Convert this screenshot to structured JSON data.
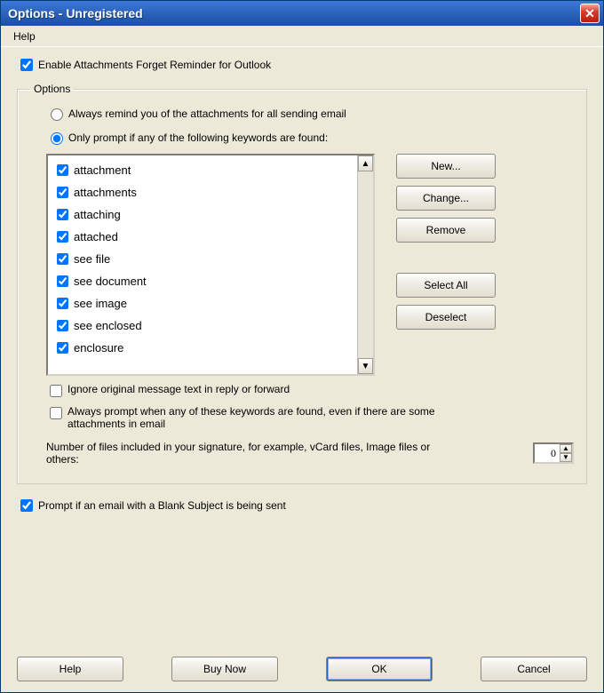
{
  "window": {
    "title": "Options - Unregistered"
  },
  "menu": {
    "help": "Help"
  },
  "enable_label": "Enable Attachments Forget Reminder for Outlook",
  "enable_checked": true,
  "group_legend": "Options",
  "radio_always": "Always remind you of the attachments for all sending email",
  "radio_keywords": "Only prompt if any of the following keywords are found:",
  "radio_selected": "keywords",
  "keywords": [
    {
      "label": "attachment",
      "checked": true
    },
    {
      "label": "attachments",
      "checked": true
    },
    {
      "label": "attaching",
      "checked": true
    },
    {
      "label": "attached",
      "checked": true
    },
    {
      "label": "see file",
      "checked": true
    },
    {
      "label": "see document",
      "checked": true
    },
    {
      "label": "see image",
      "checked": true
    },
    {
      "label": "see enclosed",
      "checked": true
    },
    {
      "label": "enclosure",
      "checked": true
    }
  ],
  "buttons": {
    "new": "New...",
    "change": "Change...",
    "remove": "Remove",
    "select_all": "Select All",
    "deselect": "Deselect"
  },
  "ignore_label": "Ignore original message text in reply or forward",
  "ignore_checked": false,
  "always_prompt_label": "Always prompt when any of these keywords are found, even if there are some attachments in email",
  "always_prompt_checked": false,
  "sig_label": "Number of files included in your signature, for example, vCard files, Image files or others:",
  "sig_value": "0",
  "blank_subject_label": "Prompt if an email with a Blank Subject is being sent",
  "blank_subject_checked": true,
  "footer": {
    "help": "Help",
    "buy": "Buy Now",
    "ok": "OK",
    "cancel": "Cancel"
  }
}
